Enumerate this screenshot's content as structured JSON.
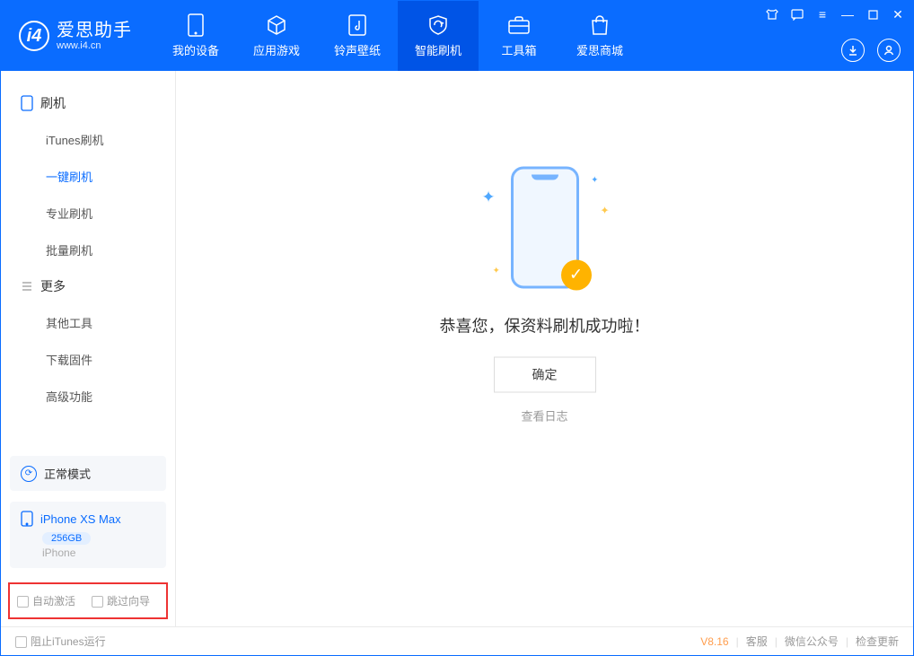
{
  "app": {
    "name": "爱思助手",
    "url": "www.i4.cn"
  },
  "nav": {
    "tabs": [
      {
        "label": "我的设备"
      },
      {
        "label": "应用游戏"
      },
      {
        "label": "铃声壁纸"
      },
      {
        "label": "智能刷机"
      },
      {
        "label": "工具箱"
      },
      {
        "label": "爱思商城"
      }
    ],
    "active_index": 3
  },
  "sidebar": {
    "group1": {
      "title": "刷机",
      "items": [
        "iTunes刷机",
        "一键刷机",
        "专业刷机",
        "批量刷机"
      ],
      "active_index": 1
    },
    "group2": {
      "title": "更多",
      "items": [
        "其他工具",
        "下载固件",
        "高级功能"
      ]
    },
    "mode_card": {
      "label": "正常模式"
    },
    "device_card": {
      "name": "iPhone XS Max",
      "capacity": "256GB",
      "type": "iPhone"
    },
    "checkbox_row": {
      "a": "自动激活",
      "b": "跳过向导"
    }
  },
  "main": {
    "success_msg": "恭喜您，保资料刷机成功啦！",
    "ok": "确定",
    "view_log": "查看日志"
  },
  "footer": {
    "block_itunes": "阻止iTunes运行",
    "version": "V8.16",
    "links": [
      "客服",
      "微信公众号",
      "检查更新"
    ]
  }
}
